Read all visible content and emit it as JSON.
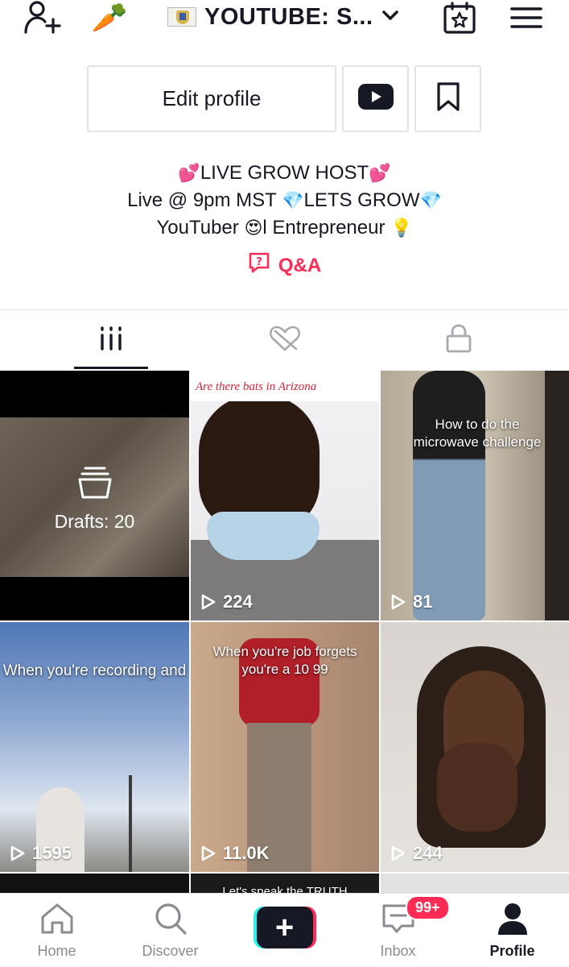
{
  "header": {
    "account_name": "YOUTUBE: S...",
    "carrot_emoji": "🥕",
    "icons": [
      "add-user-icon",
      "carrot-icon",
      "flag-icon",
      "chevron-down-icon",
      "calendar-star-icon",
      "menu-icon"
    ]
  },
  "actions": {
    "edit_profile_label": "Edit profile",
    "youtube_icon": "youtube-icon",
    "bookmark_icon": "bookmark-icon"
  },
  "bio": {
    "line1_prefix": "💕",
    "line1_text": "LIVE GROW HOST",
    "line1_suffix": "💕",
    "line2_text": "Live @ 9pm MST ",
    "line2_emoji1": "💎",
    "line2_text2": "LETS GROW",
    "line2_emoji2": "💎",
    "line3_text": "YouTuber ",
    "line3_emoji1": "😍",
    "line3_text2": "l Entrepreneur ",
    "line3_emoji2": "💡",
    "qa_label": "Q&A"
  },
  "tabs": [
    {
      "name": "videos",
      "icon": "grid-icon",
      "active": true
    },
    {
      "name": "liked",
      "icon": "heart-hidden-icon",
      "active": false
    },
    {
      "name": "private",
      "icon": "lock-icon",
      "active": false
    }
  ],
  "videos": {
    "drafts_label": "Drafts: 20",
    "v1_banner": "Are there bats in Arizona",
    "v1_views": "224",
    "v2_caption": "How to do the microwave challenge",
    "v2_views": "81",
    "v3_caption": "When you're recording and",
    "v3_views": "1595",
    "v4_caption": "When you're job forgets you're a 10 99",
    "v4_views": "11.0K",
    "v5_views": "244",
    "v6_caption": "Let's speak the TRUTH"
  },
  "nav": {
    "home": "Home",
    "discover": "Discover",
    "inbox": "Inbox",
    "inbox_badge": "99+",
    "profile": "Profile",
    "add_symbol": "+"
  },
  "colors": {
    "accent": "#fe2c55",
    "cyan": "#25f4ee",
    "text": "#161823",
    "muted": "#8a8b91"
  }
}
